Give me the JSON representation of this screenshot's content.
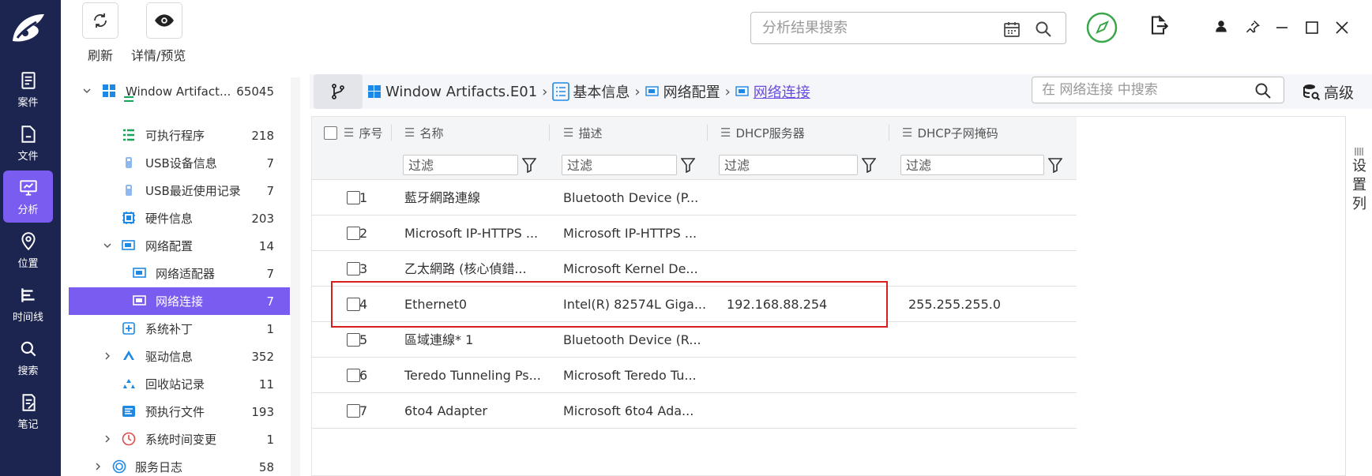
{
  "toolbar": {
    "refresh_label": "刷新",
    "preview_label": "详情/预览",
    "search_placeholder": "分析结果搜索"
  },
  "rail": {
    "items": [
      {
        "label": "案件",
        "icon": "case-icon"
      },
      {
        "label": "文件",
        "icon": "folder-icon"
      },
      {
        "label": "分析",
        "icon": "analysis-icon",
        "active": true
      },
      {
        "label": "位置",
        "icon": "location-icon"
      },
      {
        "label": "时间线",
        "icon": "timeline-icon"
      },
      {
        "label": "搜索",
        "icon": "search-icon"
      },
      {
        "label": "笔记",
        "icon": "note-icon"
      }
    ]
  },
  "tree": {
    "items": [
      {
        "label": "Window Artifact...",
        "count": "65045"
      },
      {
        "label": "",
        "count": ""
      },
      {
        "label": "可执行程序",
        "count": "218"
      },
      {
        "label": "USB设备信息",
        "count": "7"
      },
      {
        "label": "USB最近使用记录",
        "count": "7"
      },
      {
        "label": "硬件信息",
        "count": "203"
      },
      {
        "label": "网络配置",
        "count": "14"
      },
      {
        "label": "网络适配器",
        "count": "7"
      },
      {
        "label": "网络连接",
        "count": "7",
        "selected": true
      },
      {
        "label": "系统补丁",
        "count": "1"
      },
      {
        "label": "驱动信息",
        "count": "352"
      },
      {
        "label": "回收站记录",
        "count": "11"
      },
      {
        "label": "预执行文件",
        "count": "193"
      },
      {
        "label": "系统时间变更",
        "count": "1"
      },
      {
        "label": "服务日志",
        "count": "58"
      }
    ]
  },
  "breadcrumb": {
    "items": [
      "Window Artifacts.E01",
      "基本信息",
      "网络配置",
      "网络连接"
    ]
  },
  "inner_search": {
    "placeholder": "在 网络连接 中搜索"
  },
  "advanced_label": "高级",
  "grid": {
    "columns": [
      "序号",
      "名称",
      "描述",
      "DHCP服务器",
      "DHCP子网掩码"
    ],
    "filter_placeholder": "过滤",
    "rows": [
      {
        "idx": "1",
        "name": "藍牙網路連線",
        "desc": "Bluetooth Device (P...",
        "dhcp": "",
        "mask": ""
      },
      {
        "idx": "2",
        "name": "Microsoft IP-HTTPS ...",
        "desc": "Microsoft IP-HTTPS ...",
        "dhcp": "",
        "mask": ""
      },
      {
        "idx": "3",
        "name": "乙太網路 (核心偵錯...",
        "desc": "Microsoft Kernel De...",
        "dhcp": "",
        "mask": ""
      },
      {
        "idx": "4",
        "name": "Ethernet0",
        "desc": "Intel(R) 82574L Giga...",
        "dhcp": "192.168.88.254",
        "mask": "255.255.255.0"
      },
      {
        "idx": "5",
        "name": "區域連線* 1",
        "desc": "Bluetooth Device (R...",
        "dhcp": "",
        "mask": ""
      },
      {
        "idx": "6",
        "name": "Teredo Tunneling Ps...",
        "desc": "Microsoft Teredo Tu...",
        "dhcp": "",
        "mask": ""
      },
      {
        "idx": "7",
        "name": "6to4 Adapter",
        "desc": "Microsoft 6to4 Ada...",
        "dhcp": "",
        "mask": ""
      }
    ]
  },
  "column_settings": {
    "label": "设置列"
  },
  "colors": {
    "accent": "#7b5cf0",
    "rail": "#1c2450",
    "highlight": "#d81e1e"
  }
}
